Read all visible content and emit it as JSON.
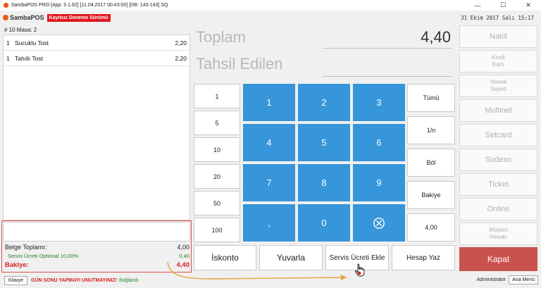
{
  "window": {
    "title": "SambaPOS PRO [App: 5.1.62] [11.04.2017 00:43:00] [DB: 143-143] SQ",
    "minimize": "—",
    "maximize": "☐",
    "close": "✕"
  },
  "header": {
    "logo": "SambaPOS",
    "trial_badge": "Kayıtsız Deneme Sürümü",
    "datetime": "31 Ekim 2017 Salı 15:17"
  },
  "ticket": {
    "table_info": "# 10 Masa: 2",
    "orders": [
      {
        "qty": "1",
        "name": "Sucuklu Tost",
        "price": "2,20"
      },
      {
        "qty": "1",
        "name": "Tahıllı Tost",
        "price": "2,20"
      }
    ],
    "ticket_total_label": "Belge Toplamı:",
    "ticket_total_value": "4,00",
    "service_label": "Servis Ücreti Optional 10,00%",
    "service_value": "0,40",
    "balance_label": "Bakiye:",
    "balance_value": "4,40"
  },
  "payment": {
    "total_label": "Toplam",
    "total_value": "4,40",
    "paid_label": "Tahsil Edilen",
    "paid_value": ""
  },
  "quick_amounts": [
    "1",
    "5",
    "10",
    "20",
    "50",
    "100"
  ],
  "numpad": [
    "1",
    "2",
    "3",
    "4",
    "5",
    "6",
    "7",
    "8",
    "9",
    ",",
    "0"
  ],
  "numpad_clear_icon": "circle-x-icon",
  "split_buttons": [
    "Tümü",
    "1/n",
    "Böl",
    "Bakiye",
    "4,00"
  ],
  "payment_types": [
    {
      "label": "Nakit"
    },
    {
      "label": "Kredi\nKartı"
    },
    {
      "label": "Yemek\nSepeti"
    },
    {
      "label": "Multinet"
    },
    {
      "label": "Setcard"
    },
    {
      "label": "Sodexo"
    },
    {
      "label": "Ticket"
    },
    {
      "label": "Online"
    },
    {
      "label": "Müşteri\nHesabı"
    }
  ],
  "actions": {
    "discount": "İskonto",
    "round": "Yuvarla",
    "service_fee": "Servis Ücreti Ekle",
    "account": "Hesap Yaz",
    "close": "Kapat"
  },
  "footer": {
    "keyboard": "Klavye",
    "warning": "GÜN SONU YAPMAYI UNUTMAYINIZ!",
    "connected": "Bağlandı",
    "user": "Administrator",
    "main_menu": "Ana Menü"
  },
  "colors": {
    "accent_blue": "#3795d9",
    "close_red": "#c9524e",
    "warning_red": "#d42020",
    "connected_green": "#2a8a2a",
    "highlight_border": "#d9534f",
    "annotation_arrow": "#e8a13a"
  }
}
